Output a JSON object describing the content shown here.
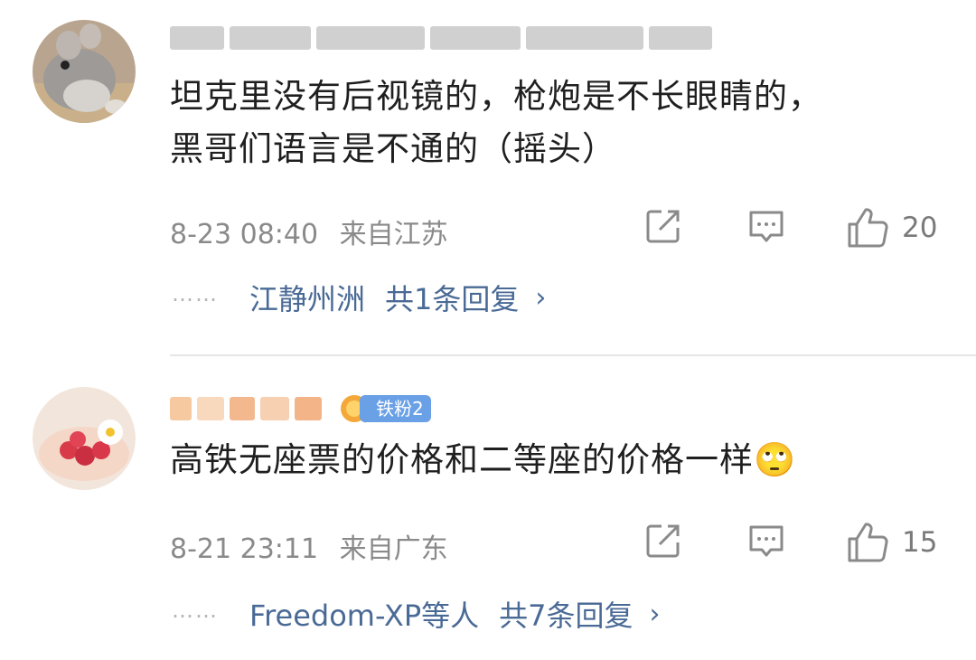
{
  "comments": [
    {
      "username": "",
      "content_line1": "坦克里没有后视镜的，枪炮是不长眼睛的，",
      "content_line2": "黑哥们语言是不通的（摇头）",
      "time": "8-23 08:40",
      "location": "来自江苏",
      "likes": "20",
      "reply_users": "江静州洲",
      "reply_count": "共1条回复",
      "reply_dots": "……",
      "chevron": "›"
    },
    {
      "username": "",
      "fan_badge": "铁粉2",
      "content_line1": "高铁无座票的价格和二等座的价格一样",
      "emoji": "🙄",
      "time": "8-21 23:11",
      "location": "来自广东",
      "likes": "15",
      "reply_users": "Freedom-XP等人",
      "reply_count": "共7条回复",
      "reply_dots": "……",
      "chevron": "›"
    }
  ],
  "icons": {
    "share": "share-icon",
    "comment": "comment-icon",
    "like": "thumbs-up-icon"
  },
  "colors": {
    "link": "#4a6a96",
    "meta": "#8a8a8a",
    "badge": "#6aa0e6"
  }
}
